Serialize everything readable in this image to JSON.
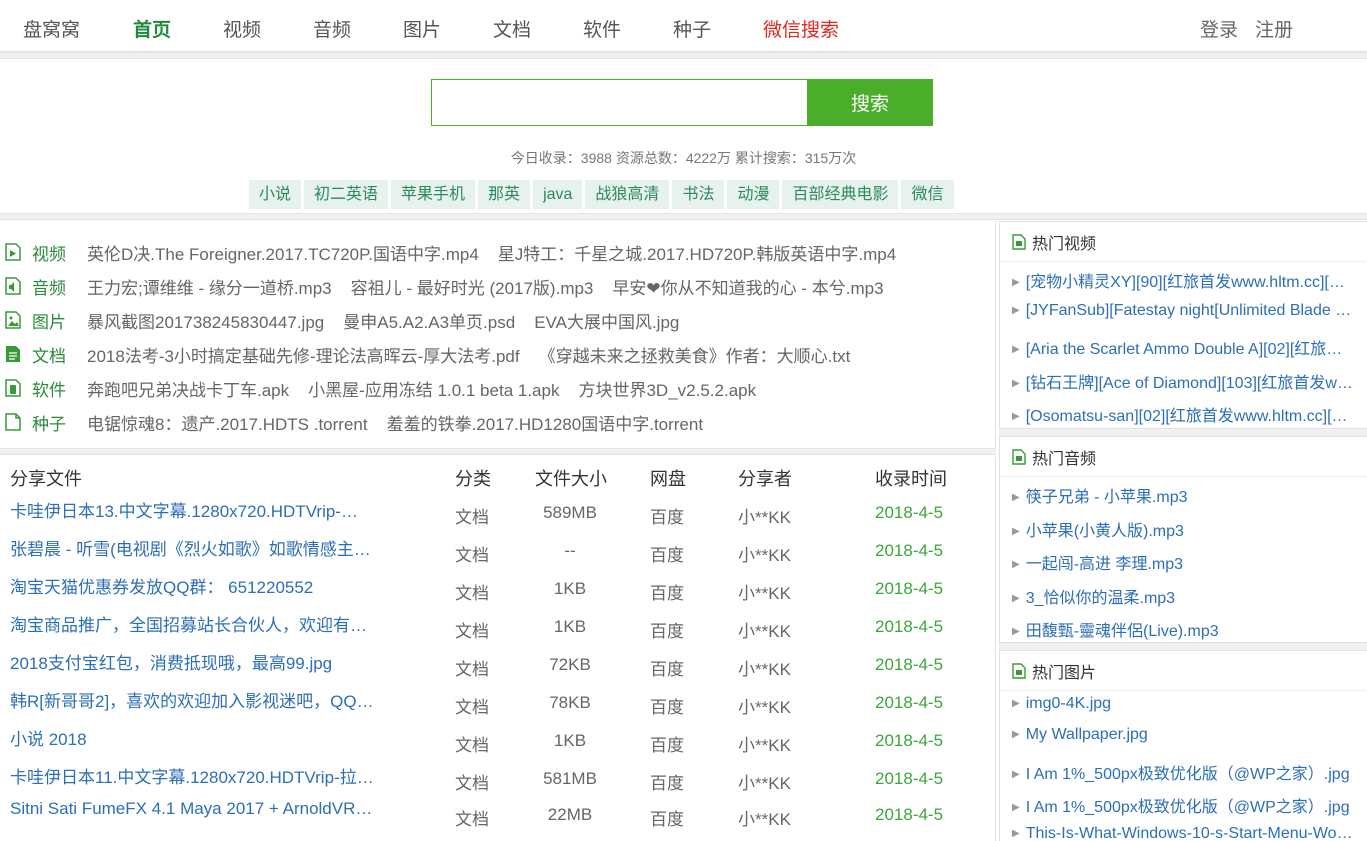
{
  "nav": {
    "items": [
      {
        "label": "盘窝窝",
        "state": "normal"
      },
      {
        "label": "首页",
        "state": "active"
      },
      {
        "label": "视频",
        "state": "normal"
      },
      {
        "label": "音频",
        "state": "normal"
      },
      {
        "label": "图片",
        "state": "normal"
      },
      {
        "label": "文档",
        "state": "normal"
      },
      {
        "label": "软件",
        "state": "normal"
      },
      {
        "label": "种子",
        "state": "normal"
      },
      {
        "label": "微信搜索",
        "state": "red"
      }
    ],
    "login": "登录",
    "register": "注册"
  },
  "search": {
    "value": "",
    "button_label": "搜索",
    "stats": "今日收录：3988 资源总数：4222万 累计搜索：315万次"
  },
  "hotwords": [
    "小说",
    "初二英语",
    "苹果手机",
    "那英",
    "java",
    "战狼高清",
    "书法",
    "动漫",
    "百部经典电影",
    "微信"
  ],
  "categories": [
    {
      "icon": "video-file-icon",
      "label": "视频",
      "links": [
        "英伦D决.The Foreigner.2017.TC720P.国语中字.mp4",
        "星J特工：千星之城.2017.HD720P.韩版英语中字.mp4"
      ]
    },
    {
      "icon": "audio-file-icon",
      "label": "音频",
      "links": [
        "王力宏;谭维维 - 缘分一道桥.mp3",
        "容祖儿 - 最好时光 (2017版).mp3",
        "早安❤你从不知道我的心 - 本兮.mp3"
      ]
    },
    {
      "icon": "image-file-icon",
      "label": "图片",
      "links": [
        "暴风截图201738245830447.jpg",
        "曼申A5.A2.A3单页.psd",
        "EVA大展中国风.jpg"
      ]
    },
    {
      "icon": "document-file-icon",
      "label": "文档",
      "links": [
        "2018法考-3小时搞定基础先修-理论法高晖云-厚大法考.pdf",
        "《穿越未来之拯救美食》作者：大顺心.txt"
      ]
    },
    {
      "icon": "software-file-icon",
      "label": "软件",
      "links": [
        "奔跑吧兄弟决战卡丁车.apk",
        "小黑屋-应用冻结 1.0.1 beta 1.apk",
        "方块世界3D_v2.5.2.apk"
      ]
    },
    {
      "icon": "torrent-file-icon",
      "label": "种子",
      "links": [
        "电锯惊魂8：遗产.2017.HDTS .torrent",
        "羞羞的铁拳.2017.HD1280国语中字.torrent"
      ]
    }
  ],
  "files": {
    "headers": [
      "分享文件",
      "分类",
      "文件大小",
      "网盘",
      "分享者",
      "收录时间"
    ],
    "rows": [
      {
        "name": "卡哇伊日本13.中文字幕.1280x720.HDTVrip-…",
        "type": "文档",
        "size": "589MB",
        "disk": "百度",
        "sharer": "小**KK",
        "date": "2018-4-5"
      },
      {
        "name": "张碧晨 - 听雪(电视剧《烈火如歌》如歌情感主…",
        "type": "文档",
        "size": "--",
        "disk": "百度",
        "sharer": "小**KK",
        "date": "2018-4-5"
      },
      {
        "name": "淘宝天猫优惠券发放QQ群： 651220552",
        "type": "文档",
        "size": "1KB",
        "disk": "百度",
        "sharer": "小**KK",
        "date": "2018-4-5"
      },
      {
        "name": "淘宝商品推广，全国招募站长合伙人，欢迎有…",
        "type": "文档",
        "size": "1KB",
        "disk": "百度",
        "sharer": "小**KK",
        "date": "2018-4-5"
      },
      {
        "name": "2018支付宝红包，消费抵现哦，最高99.jpg",
        "type": "文档",
        "size": "72KB",
        "disk": "百度",
        "sharer": "小**KK",
        "date": "2018-4-5"
      },
      {
        "name": "韩R[新哥哥2]，喜欢的欢迎加入影视迷吧，QQ…",
        "type": "文档",
        "size": "78KB",
        "disk": "百度",
        "sharer": "小**KK",
        "date": "2018-4-5"
      },
      {
        "name": "小说 2018",
        "type": "文档",
        "size": "1KB",
        "disk": "百度",
        "sharer": "小**KK",
        "date": "2018-4-5"
      },
      {
        "name": "卡哇伊日本11.中文字幕.1280x720.HDTVrip-拉…",
        "type": "文档",
        "size": "581MB",
        "disk": "百度",
        "sharer": "小**KK",
        "date": "2018-4-5"
      },
      {
        "name": "Sitni Sati FumeFX 4.1 Maya 2017 + ArnoldVR…",
        "type": "文档",
        "size": "22MB",
        "disk": "百度",
        "sharer": "小**KK",
        "date": "2018-4-5"
      }
    ]
  },
  "sidebar": {
    "hot_video": {
      "title": "热门视频",
      "items": [
        "[宠物小精灵XY][90][红旅首发www.hltm.cc][…",
        "[JYFanSub][Fatestay night[Unlimited Blade …",
        "[Aria the Scarlet Ammo Double A][02][红旅…",
        "[钻石王牌][Ace of Diamond][103][红旅首发w…",
        "[Osomatsu-san][02][红旅首发www.hltm.cc][…"
      ]
    },
    "hot_audio": {
      "title": "热门音频",
      "items": [
        "筷子兄弟 - 小苹果.mp3",
        "小苹果(小黄人版).mp3",
        "一起闯-高进 李理.mp3",
        "3_恰似你的温柔.mp3",
        "田馥甄-靈魂伴侶(Live).mp3"
      ]
    },
    "hot_image": {
      "title": "热门图片",
      "items": [
        "img0-4K.jpg",
        "My Wallpaper.jpg",
        "I Am 1%_500px极致优化版（@WP之家）.jpg",
        "I Am 1%_500px极致优化版（@WP之家）.jpg",
        "This-Is-What-Windows-10-s-Start-Menu-Wo…"
      ]
    }
  },
  "colors": {
    "accent_green": "#4aae2a",
    "active_nav": "#1e8a3c",
    "link_blue": "#2c6fb7",
    "date_green": "#3aa83a",
    "red_nav": "#e0281f"
  }
}
